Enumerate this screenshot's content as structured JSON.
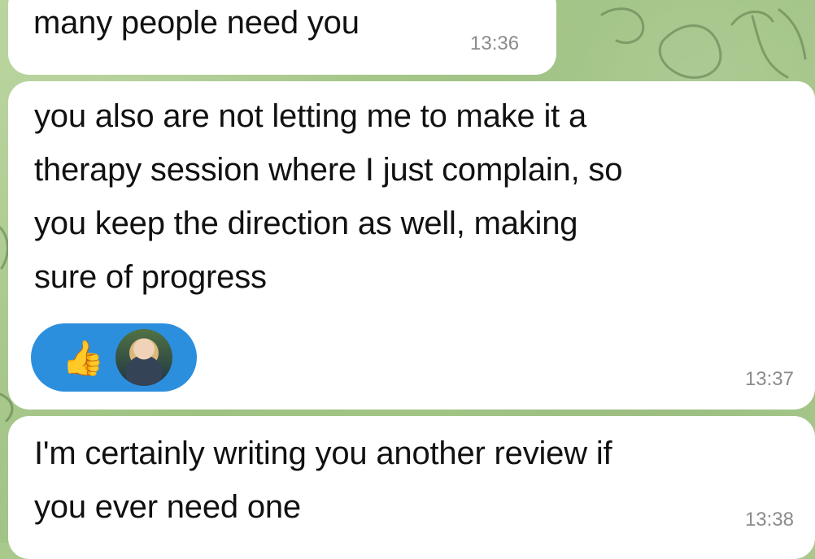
{
  "chat": {
    "messages": [
      {
        "text": "many people need you",
        "time": "13:36"
      },
      {
        "text": "you also are not letting me to make it a\ntherapy session where I just complain, so\nyou keep the direction as well, making\nsure of progress",
        "time": "13:37",
        "reaction": {
          "emoji": "👍",
          "icon": "thumbs-up-icon",
          "avatar": "reactor-avatar"
        }
      },
      {
        "text": "I'm certainly writing you another review if\nyou ever need one",
        "time": "13:38"
      }
    ]
  },
  "colors": {
    "background": "#a9c98c",
    "bubble": "#ffffff",
    "reaction_pill": "#2c8fde",
    "timestamp": "#8b8b8b"
  }
}
